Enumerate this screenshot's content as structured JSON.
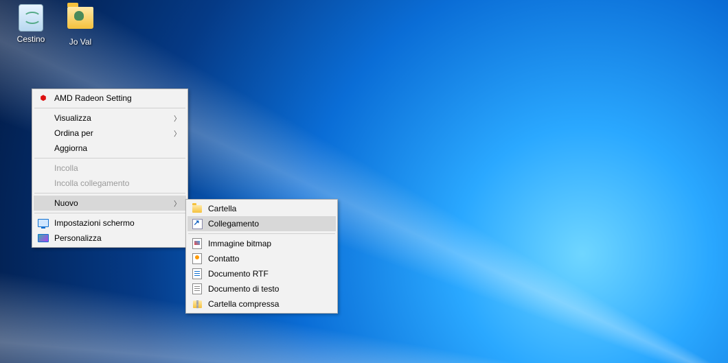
{
  "desktop_icons": {
    "recycle_bin": "Cestino",
    "user_folder": "Jo Val"
  },
  "context_menu": {
    "amd": "AMD Radeon Setting",
    "view": "Visualizza",
    "sort": "Ordina per",
    "refresh": "Aggiorna",
    "paste": "Incolla",
    "paste_shortcut": "Incolla collegamento",
    "new": "Nuovo",
    "display_settings": "Impostazioni schermo",
    "personalize": "Personalizza"
  },
  "submenu_new": {
    "folder": "Cartella",
    "shortcut": "Collegamento",
    "bitmap": "Immagine bitmap",
    "contact": "Contatto",
    "rtf": "Documento RTF",
    "text": "Documento di testo",
    "compressed": "Cartella compressa"
  }
}
